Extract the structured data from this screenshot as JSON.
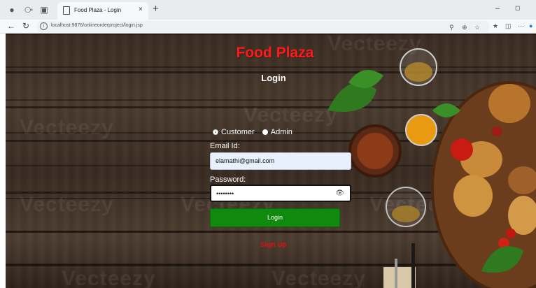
{
  "browser": {
    "tab_title": "Food Plaza - Login",
    "tab_close": "×",
    "new_tab": "+",
    "url": "localhost:9876/onlineorderproject/login.jsp",
    "window_min": "–",
    "window_max": "◻"
  },
  "page": {
    "brand": "Food Plaza",
    "heading": "Login",
    "roles": [
      {
        "label": "Customer",
        "checked": false
      },
      {
        "label": "Admin",
        "checked": true
      }
    ],
    "email_label": "Email Id:",
    "email_value": "elamathi@gmail.com",
    "password_label": "Password:",
    "password_value": "••••••••",
    "login_button": "Login",
    "signup_link": "Sign Up"
  },
  "watermark": "Vecteezy",
  "colors": {
    "brand": "#ff1a1a",
    "login_button": "#0f8a0f",
    "signup": "#e01010"
  }
}
